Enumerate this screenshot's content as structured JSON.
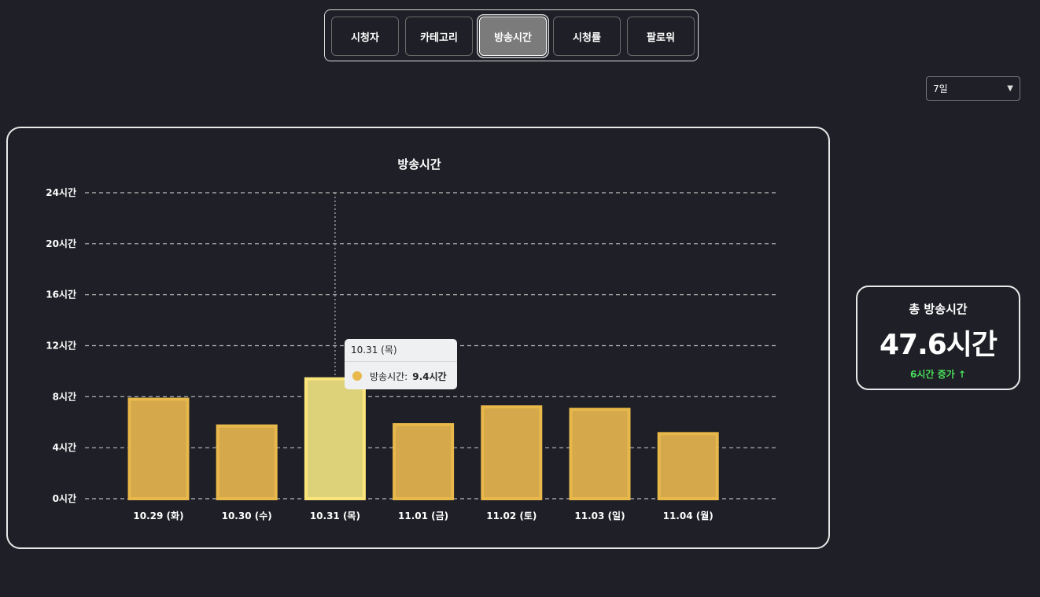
{
  "tabs": [
    {
      "label": "시청자",
      "active": false
    },
    {
      "label": "카테고리",
      "active": false
    },
    {
      "label": "방송시간",
      "active": true
    },
    {
      "label": "시청률",
      "active": false
    },
    {
      "label": "팔로워",
      "active": false
    }
  ],
  "period": {
    "selected": "7일"
  },
  "tooltip": {
    "title": "10.31 (목)",
    "series_label": "방송시간:",
    "value": "9.4시간"
  },
  "summary": {
    "label": "총 방송시간",
    "value": "47.6시간",
    "change": "6시간 증가 ↑"
  },
  "colors": {
    "bar_fill": "#d4a84b",
    "bar_border": "#e8b84a",
    "bar_highlight_fill": "#ddd27a",
    "bar_highlight_border": "#fbe57a",
    "tooltip_dot": "#e8b84a",
    "accent_green": "#4ade5a"
  },
  "chart_data": {
    "type": "bar",
    "title": "방송시간",
    "categories": [
      "10.29 (화)",
      "10.30 (수)",
      "10.31 (목)",
      "11.01 (금)",
      "11.02 (토)",
      "11.03 (일)",
      "11.04 (월)"
    ],
    "values": [
      7.8,
      5.7,
      9.4,
      5.8,
      7.2,
      7.0,
      5.1
    ],
    "yticks": [
      "0시간",
      "4시간",
      "8시간",
      "12시간",
      "16시간",
      "20시간",
      "24시간"
    ],
    "ylim": [
      0,
      24
    ],
    "highlight_index": 2,
    "grid": true,
    "legend": "none"
  }
}
